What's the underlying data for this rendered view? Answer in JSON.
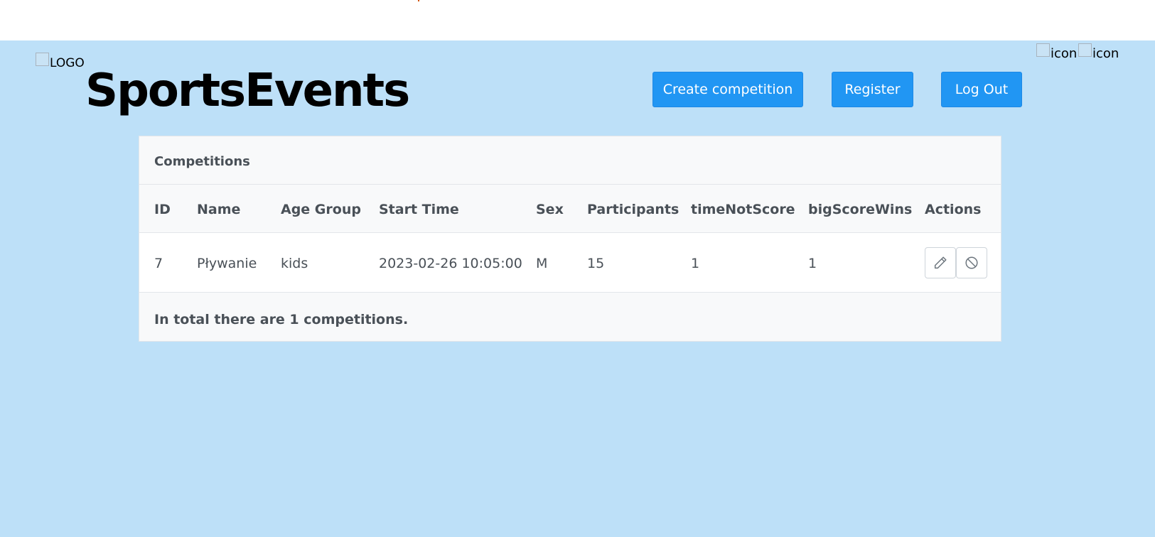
{
  "header": {
    "logo_alt": "LOGO",
    "brand": "SportsEvents",
    "icons": [
      {
        "alt": "icon"
      },
      {
        "alt": "icon"
      }
    ],
    "buttons": {
      "create": "Create competition",
      "register": "Register",
      "logout": "Log Out"
    }
  },
  "table": {
    "title": "Competitions",
    "columns": [
      "ID",
      "Name",
      "Age Group",
      "Start Time",
      "Sex",
      "Participants",
      "timeNotScore",
      "bigScoreWins",
      "Actions"
    ],
    "rows": [
      {
        "id": "7",
        "name": "Pływanie",
        "age_group": "kids",
        "start_time": "2023-02-26 10:05:00",
        "sex": "M",
        "participants": "15",
        "time_not_score": "1",
        "big_score_wins": "1",
        "actions": [
          {
            "icon": "pencil-icon"
          },
          {
            "icon": "ban-icon"
          }
        ]
      }
    ],
    "footer": "In total there are 1 competitions."
  },
  "colors": {
    "background": "#bde0f8",
    "primary_button": "#2196f3",
    "card": "#f8f9fa"
  }
}
